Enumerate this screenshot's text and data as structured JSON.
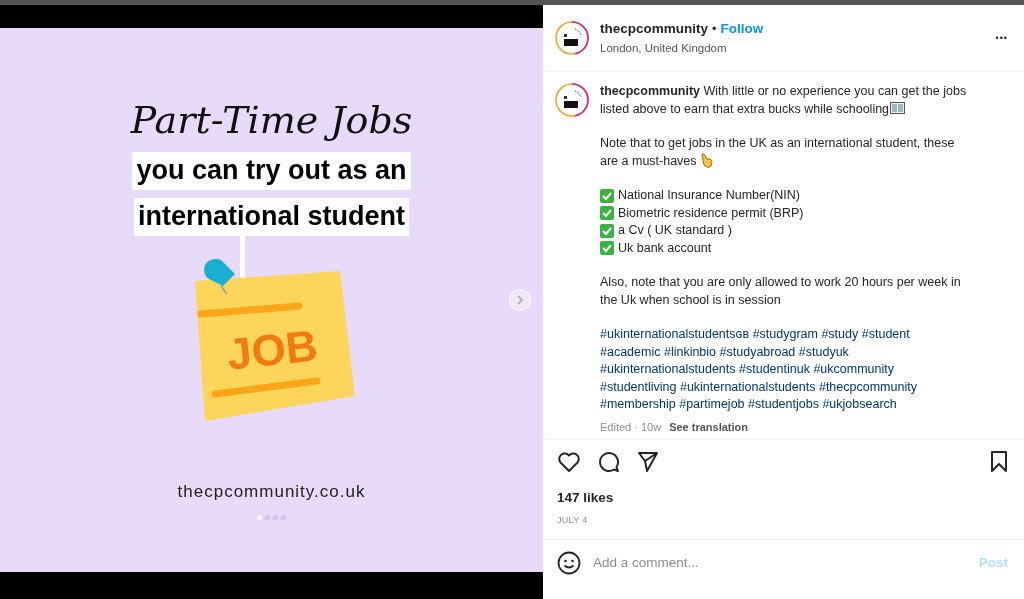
{
  "slide": {
    "title": "Part-Time Jobs",
    "subtitle_lines": [
      "you can try out as an",
      "international student"
    ],
    "note_label": "JOB",
    "website": "thecpcommunity.co.uk",
    "dots": [
      {
        "selected": true
      },
      {
        "selected": false
      },
      {
        "selected": false
      },
      {
        "selected": false
      }
    ]
  },
  "header": {
    "username": "thecpcommunity",
    "separator": "•",
    "follow": "Follow",
    "location": "London, United Kingdom",
    "more": "•••"
  },
  "caption": {
    "username": "thecpcommunity",
    "intro": "With little or no experience you can get the jobs listed above to earn that extra bucks while schooling",
    "note": "Note that to get jobs in the UK as an international student, these are a must-haves",
    "requirements": [
      "National Insurance Number(NIN)",
      "Biometric residence permit (BRP)",
      "a Cv ( UK standard )",
      "Uk bank account"
    ],
    "also": "Also, note that you are only allowed to work 20 hours per week in the Uk when school is in session",
    "hashtags": [
      "#ukinternationalstudentsɢʙ",
      "#studygram",
      "#study",
      "#student",
      "#academic",
      "#linkinbio",
      "#studyabroad",
      "#studyuk",
      "#ukinternationalstudents",
      "#studentinuk",
      "#ukcommunity",
      "#studentliving",
      "#ukinternationalstudents",
      "#thecpcommunity",
      "#membership",
      "#partimejob",
      "#studentjobs",
      "#ukjobsearch"
    ],
    "edited": "Edited · 10w",
    "translate": "See translation"
  },
  "likes": "147 likes",
  "date": "JULY 4",
  "comment": {
    "placeholder": "Add a comment...",
    "post": "Post"
  }
}
